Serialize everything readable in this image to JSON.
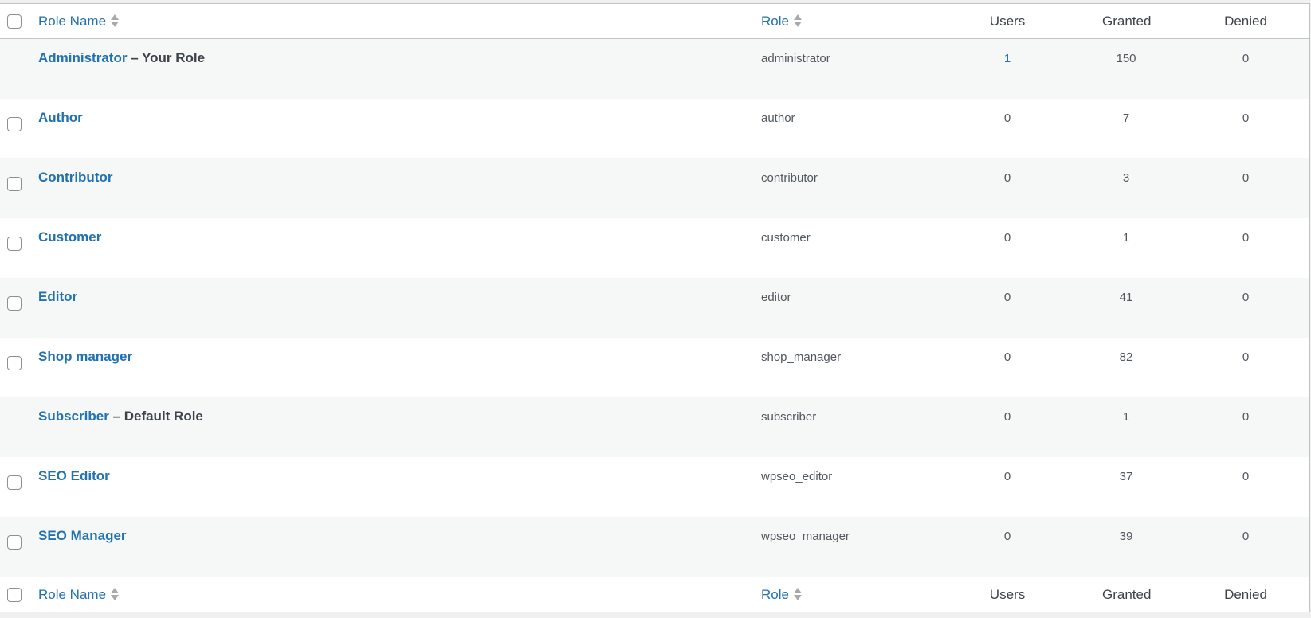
{
  "columns": {
    "role_name": "Role Name",
    "role": "Role",
    "users": "Users",
    "granted": "Granted",
    "denied": "Denied"
  },
  "rows": [
    {
      "name": "Administrator",
      "suffix": " – Your Role",
      "role": "administrator",
      "users": "1",
      "granted": "150",
      "denied": "0",
      "checkbox": false
    },
    {
      "name": "Author",
      "suffix": "",
      "role": "author",
      "users": "0",
      "granted": "7",
      "denied": "0",
      "checkbox": true
    },
    {
      "name": "Contributor",
      "suffix": "",
      "role": "contributor",
      "users": "0",
      "granted": "3",
      "denied": "0",
      "checkbox": true
    },
    {
      "name": "Customer",
      "suffix": "",
      "role": "customer",
      "users": "0",
      "granted": "1",
      "denied": "0",
      "checkbox": true
    },
    {
      "name": "Editor",
      "suffix": "",
      "role": "editor",
      "users": "0",
      "granted": "41",
      "denied": "0",
      "checkbox": true
    },
    {
      "name": "Shop manager",
      "suffix": "",
      "role": "shop_manager",
      "users": "0",
      "granted": "82",
      "denied": "0",
      "checkbox": true
    },
    {
      "name": "Subscriber",
      "suffix": " – Default Role",
      "role": "subscriber",
      "users": "0",
      "granted": "1",
      "denied": "0",
      "checkbox": false
    },
    {
      "name": "SEO Editor",
      "suffix": "",
      "role": "wpseo_editor",
      "users": "0",
      "granted": "37",
      "denied": "0",
      "checkbox": true
    },
    {
      "name": "SEO Manager",
      "suffix": "",
      "role": "wpseo_manager",
      "users": "0",
      "granted": "39",
      "denied": "0",
      "checkbox": true
    }
  ],
  "colors": {
    "link": "#2271b1",
    "text": "#3c434a",
    "alt_row": "#f6f7f7"
  }
}
